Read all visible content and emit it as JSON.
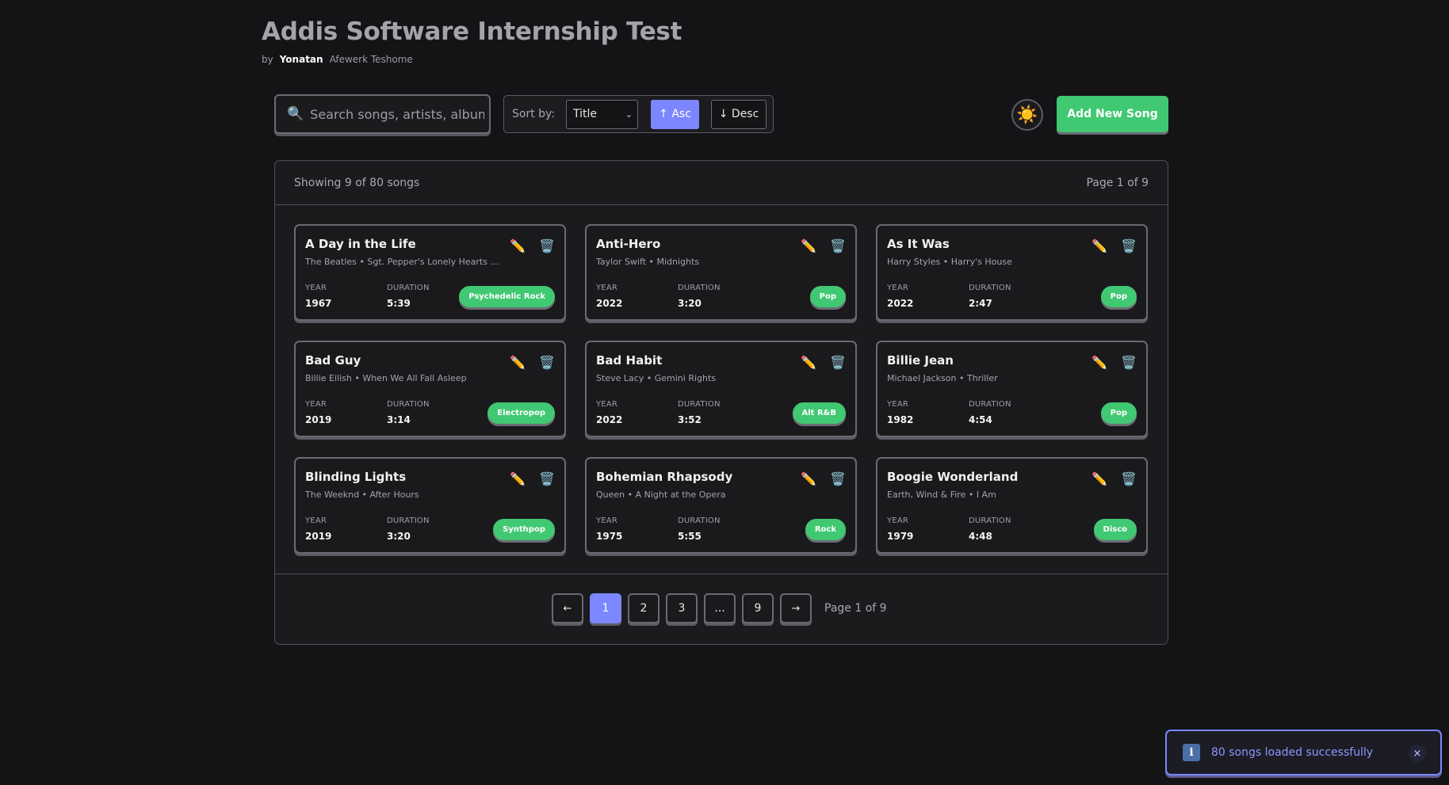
{
  "header": {
    "title": "Addis Software Internship Test",
    "by": "by",
    "author_first": "Yonatan",
    "author_rest": "Afewerk Teshome"
  },
  "toolbar": {
    "search_placeholder": "Search songs, artists, albums...",
    "sort_label": "Sort by:",
    "sort_value": "Title",
    "asc_label": "↑ Asc",
    "desc_label": "↓ Desc",
    "theme_icon": "☀️",
    "add_label": "Add New Song"
  },
  "list": {
    "showing": "Showing 9 of 80 songs",
    "page_info": "Page 1 of 9",
    "year_label": "YEAR",
    "duration_label": "DURATION",
    "songs": [
      {
        "title": "A Day in the Life",
        "sub": "The Beatles • Sgt. Pepper's Lonely Hearts Club Band",
        "year": "1967",
        "duration": "5:39",
        "genre": "Psychedelic Rock"
      },
      {
        "title": "Anti-Hero",
        "sub": "Taylor Swift • Midnights",
        "year": "2022",
        "duration": "3:20",
        "genre": "Pop"
      },
      {
        "title": "As It Was",
        "sub": "Harry Styles • Harry's House",
        "year": "2022",
        "duration": "2:47",
        "genre": "Pop"
      },
      {
        "title": "Bad Guy",
        "sub": "Billie Eilish • When We All Fall Asleep",
        "year": "2019",
        "duration": "3:14",
        "genre": "Electropop"
      },
      {
        "title": "Bad Habit",
        "sub": "Steve Lacy • Gemini Rights",
        "year": "2022",
        "duration": "3:52",
        "genre": "Alt R&B"
      },
      {
        "title": "Billie Jean",
        "sub": "Michael Jackson • Thriller",
        "year": "1982",
        "duration": "4:54",
        "genre": "Pop"
      },
      {
        "title": "Blinding Lights",
        "sub": "The Weeknd • After Hours",
        "year": "2019",
        "duration": "3:20",
        "genre": "Synthpop"
      },
      {
        "title": "Bohemian Rhapsody",
        "sub": "Queen • A Night at the Opera",
        "year": "1975",
        "duration": "5:55",
        "genre": "Rock"
      },
      {
        "title": "Boogie Wonderland",
        "sub": "Earth, Wind & Fire • I Am",
        "year": "1979",
        "duration": "4:48",
        "genre": "Disco"
      }
    ]
  },
  "pagination": {
    "prev": "←",
    "pages": [
      "1",
      "2",
      "3",
      "...",
      "9"
    ],
    "active_page": "1",
    "next": "→",
    "label": "Page 1 of 9"
  },
  "toast": {
    "icon": "i",
    "message": "80 songs loaded successfully",
    "close": "×"
  },
  "colors": {
    "accent": "#7c86ff",
    "success": "#41c872",
    "background": "#141416"
  }
}
